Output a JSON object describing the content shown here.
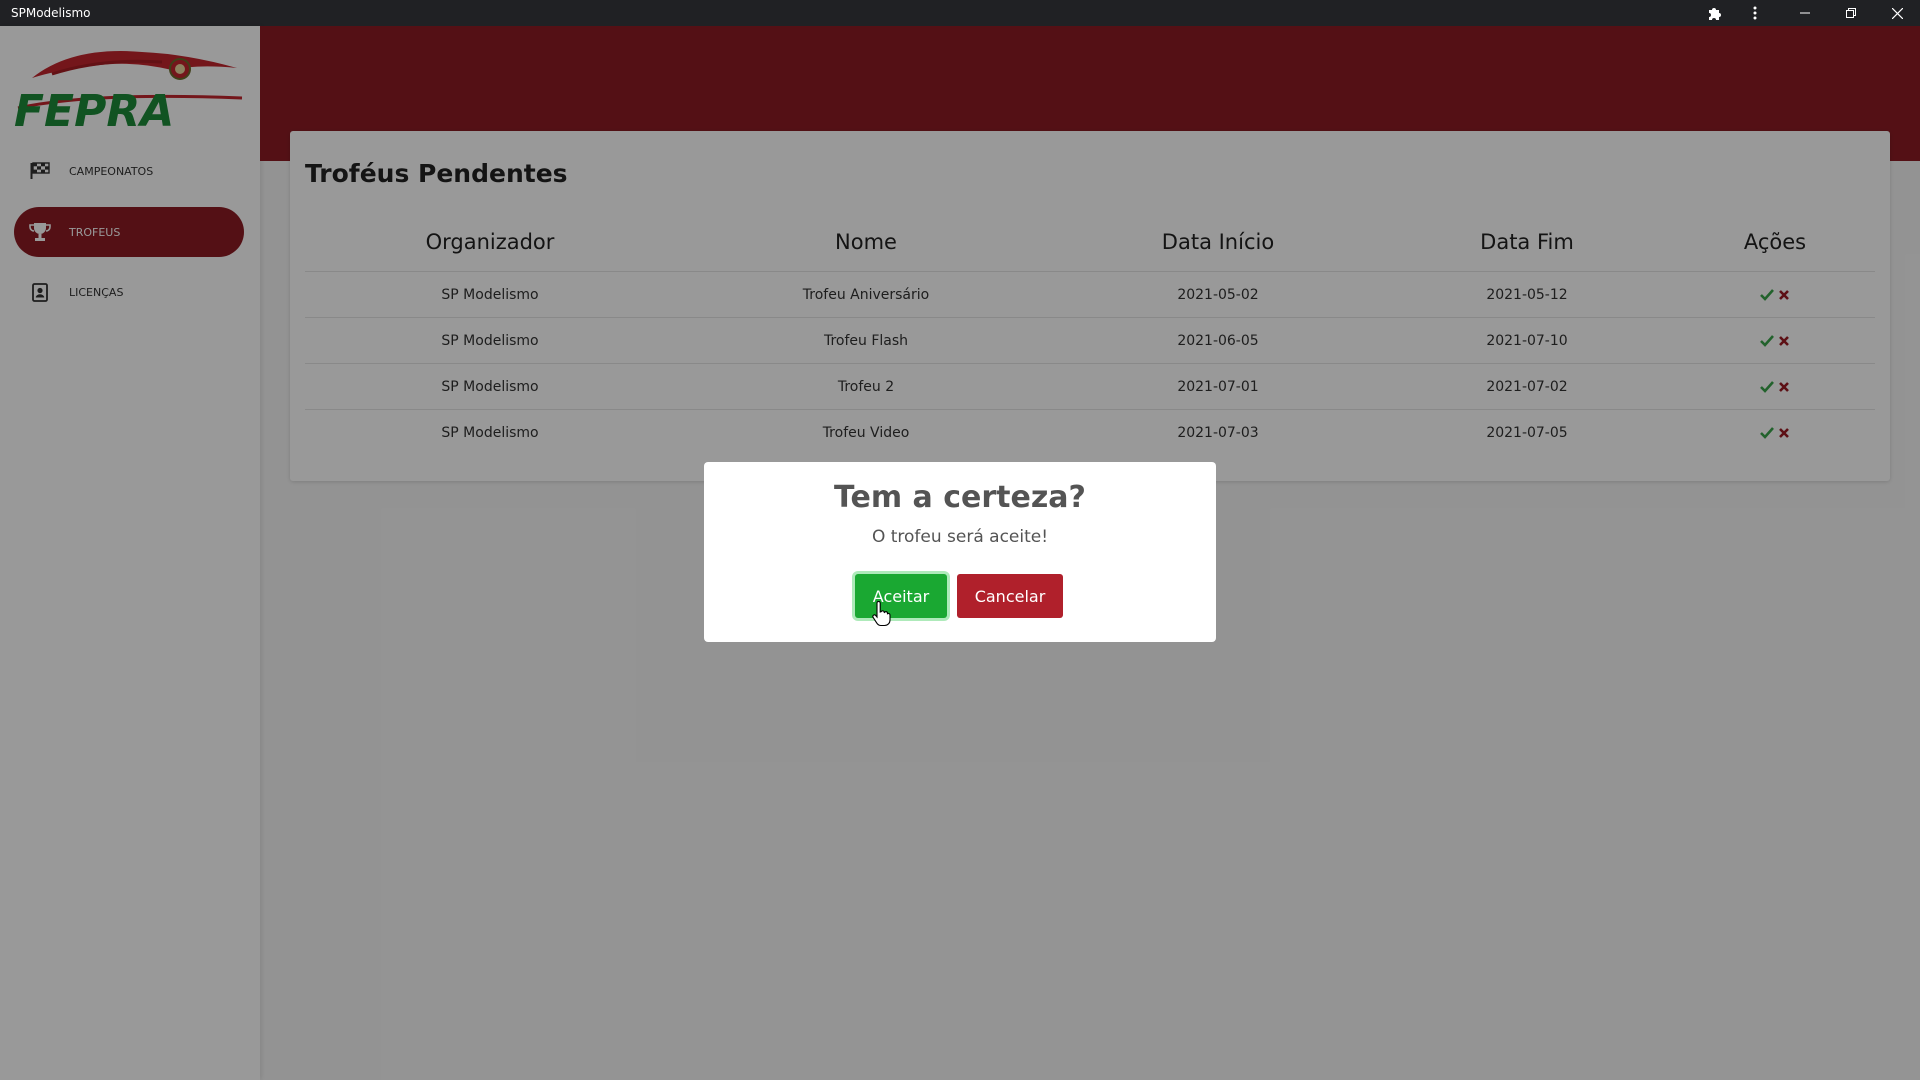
{
  "window": {
    "title": "SPModelismo",
    "controls": [
      "extensions-icon",
      "more-vert-icon",
      "minimize-icon",
      "restore-icon",
      "close-icon"
    ]
  },
  "sidebar": {
    "logo_text": "FEPRA",
    "items": [
      {
        "label": "CAMPEONATOS",
        "icon": "checkered-flag-icon",
        "active": false
      },
      {
        "label": "TROFEUS",
        "icon": "trophy-icon",
        "active": true
      },
      {
        "label": "LICENÇAS",
        "icon": "id-card-icon",
        "active": false
      }
    ]
  },
  "main": {
    "title": "Troféus Pendentes",
    "table": {
      "headers": [
        "Organizador",
        "Nome",
        "Data Início",
        "Data Fim",
        "Ações"
      ],
      "rows": [
        [
          "SP Modelismo",
          "Trofeu Aniversário",
          "2021-05-02",
          "2021-05-12"
        ],
        [
          "SP Modelismo",
          "Trofeu Flash",
          "2021-06-05",
          "2021-07-10"
        ],
        [
          "SP Modelismo",
          "Trofeu 2",
          "2021-07-01",
          "2021-07-02"
        ],
        [
          "SP Modelismo",
          "Trofeu Video",
          "2021-07-03",
          "2021-07-05"
        ]
      ],
      "actions": [
        "accept-check-icon",
        "reject-x-icon"
      ]
    }
  },
  "modal": {
    "title": "Tem a certeza?",
    "text": "O trofeu será aceite!",
    "confirm_label": "Aceitar",
    "cancel_label": "Cancelar"
  },
  "colors": {
    "brand_red": "#8c1c24",
    "accept_green": "#1aa832",
    "cancel_red": "#b0202b",
    "check_green": "#3aa34a",
    "x_red": "#9c1c24"
  }
}
